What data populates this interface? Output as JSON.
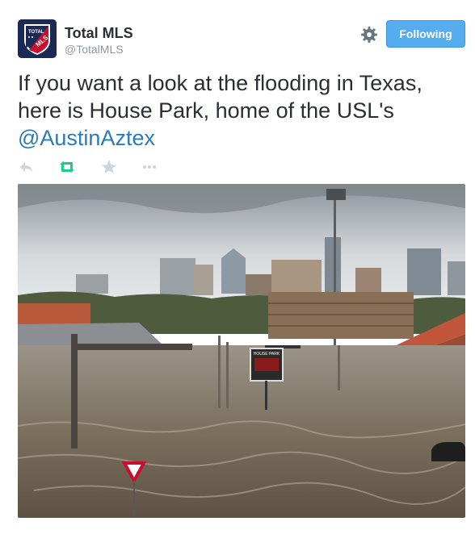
{
  "user": {
    "display_name": "Total MLS",
    "screen_name": "@TotalMLS",
    "avatar_icon": "total-mls-shield-logo"
  },
  "follow_button": {
    "label": "Following"
  },
  "settings_icon": "gear-icon",
  "tweet": {
    "text_before_mention": "If you want a look at the flooding in Texas, here is House Park, home of the USL's ",
    "mention": "@AustinAztex"
  },
  "actions": [
    {
      "name": "reply-icon"
    },
    {
      "name": "retweet-icon"
    },
    {
      "name": "favorite-icon"
    },
    {
      "name": "more-icon"
    }
  ],
  "photo": {
    "description_icon": "flooded-stadium-photo",
    "scoreboard_text": "HOUSE PARK"
  },
  "colors": {
    "follow_button": "#55acee",
    "mention": "#2b7bb9",
    "retweet_active": "#19cf86",
    "muted_icon": "#ccd6dd"
  }
}
